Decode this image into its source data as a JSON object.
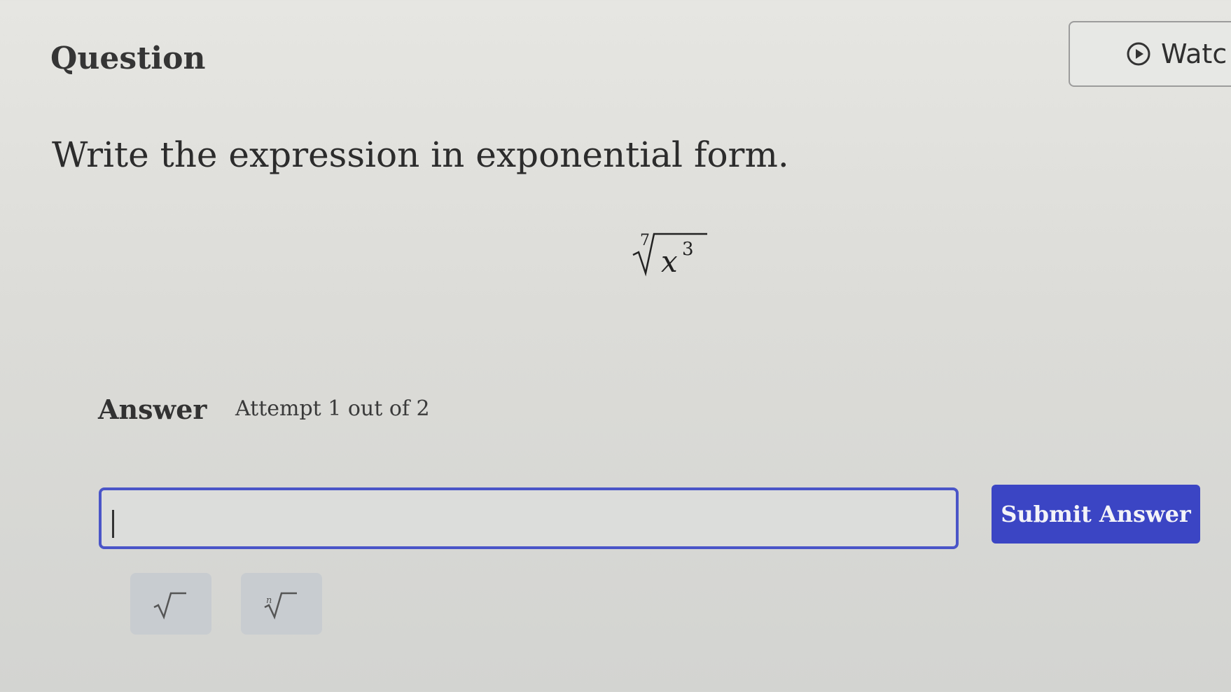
{
  "header": {
    "title": "Question",
    "watch_button_label": "Watc"
  },
  "question": {
    "prompt": "Write the expression in exponential form.",
    "expression": {
      "root_index": "7",
      "base": "x",
      "exponent": "3"
    }
  },
  "answer": {
    "label": "Answer",
    "attempt_text": "Attempt 1 out of 2",
    "input_value": "",
    "submit_label": "Submit Answer"
  },
  "tools": [
    {
      "name": "square-root",
      "icon": "sqrt-icon"
    },
    {
      "name": "nth-root",
      "icon": "nth-root-icon",
      "index_glyph": "n"
    }
  ],
  "colors": {
    "accent": "#3b45c4",
    "input_border": "#4a55c8",
    "tool_background": "#c8ccd0"
  }
}
